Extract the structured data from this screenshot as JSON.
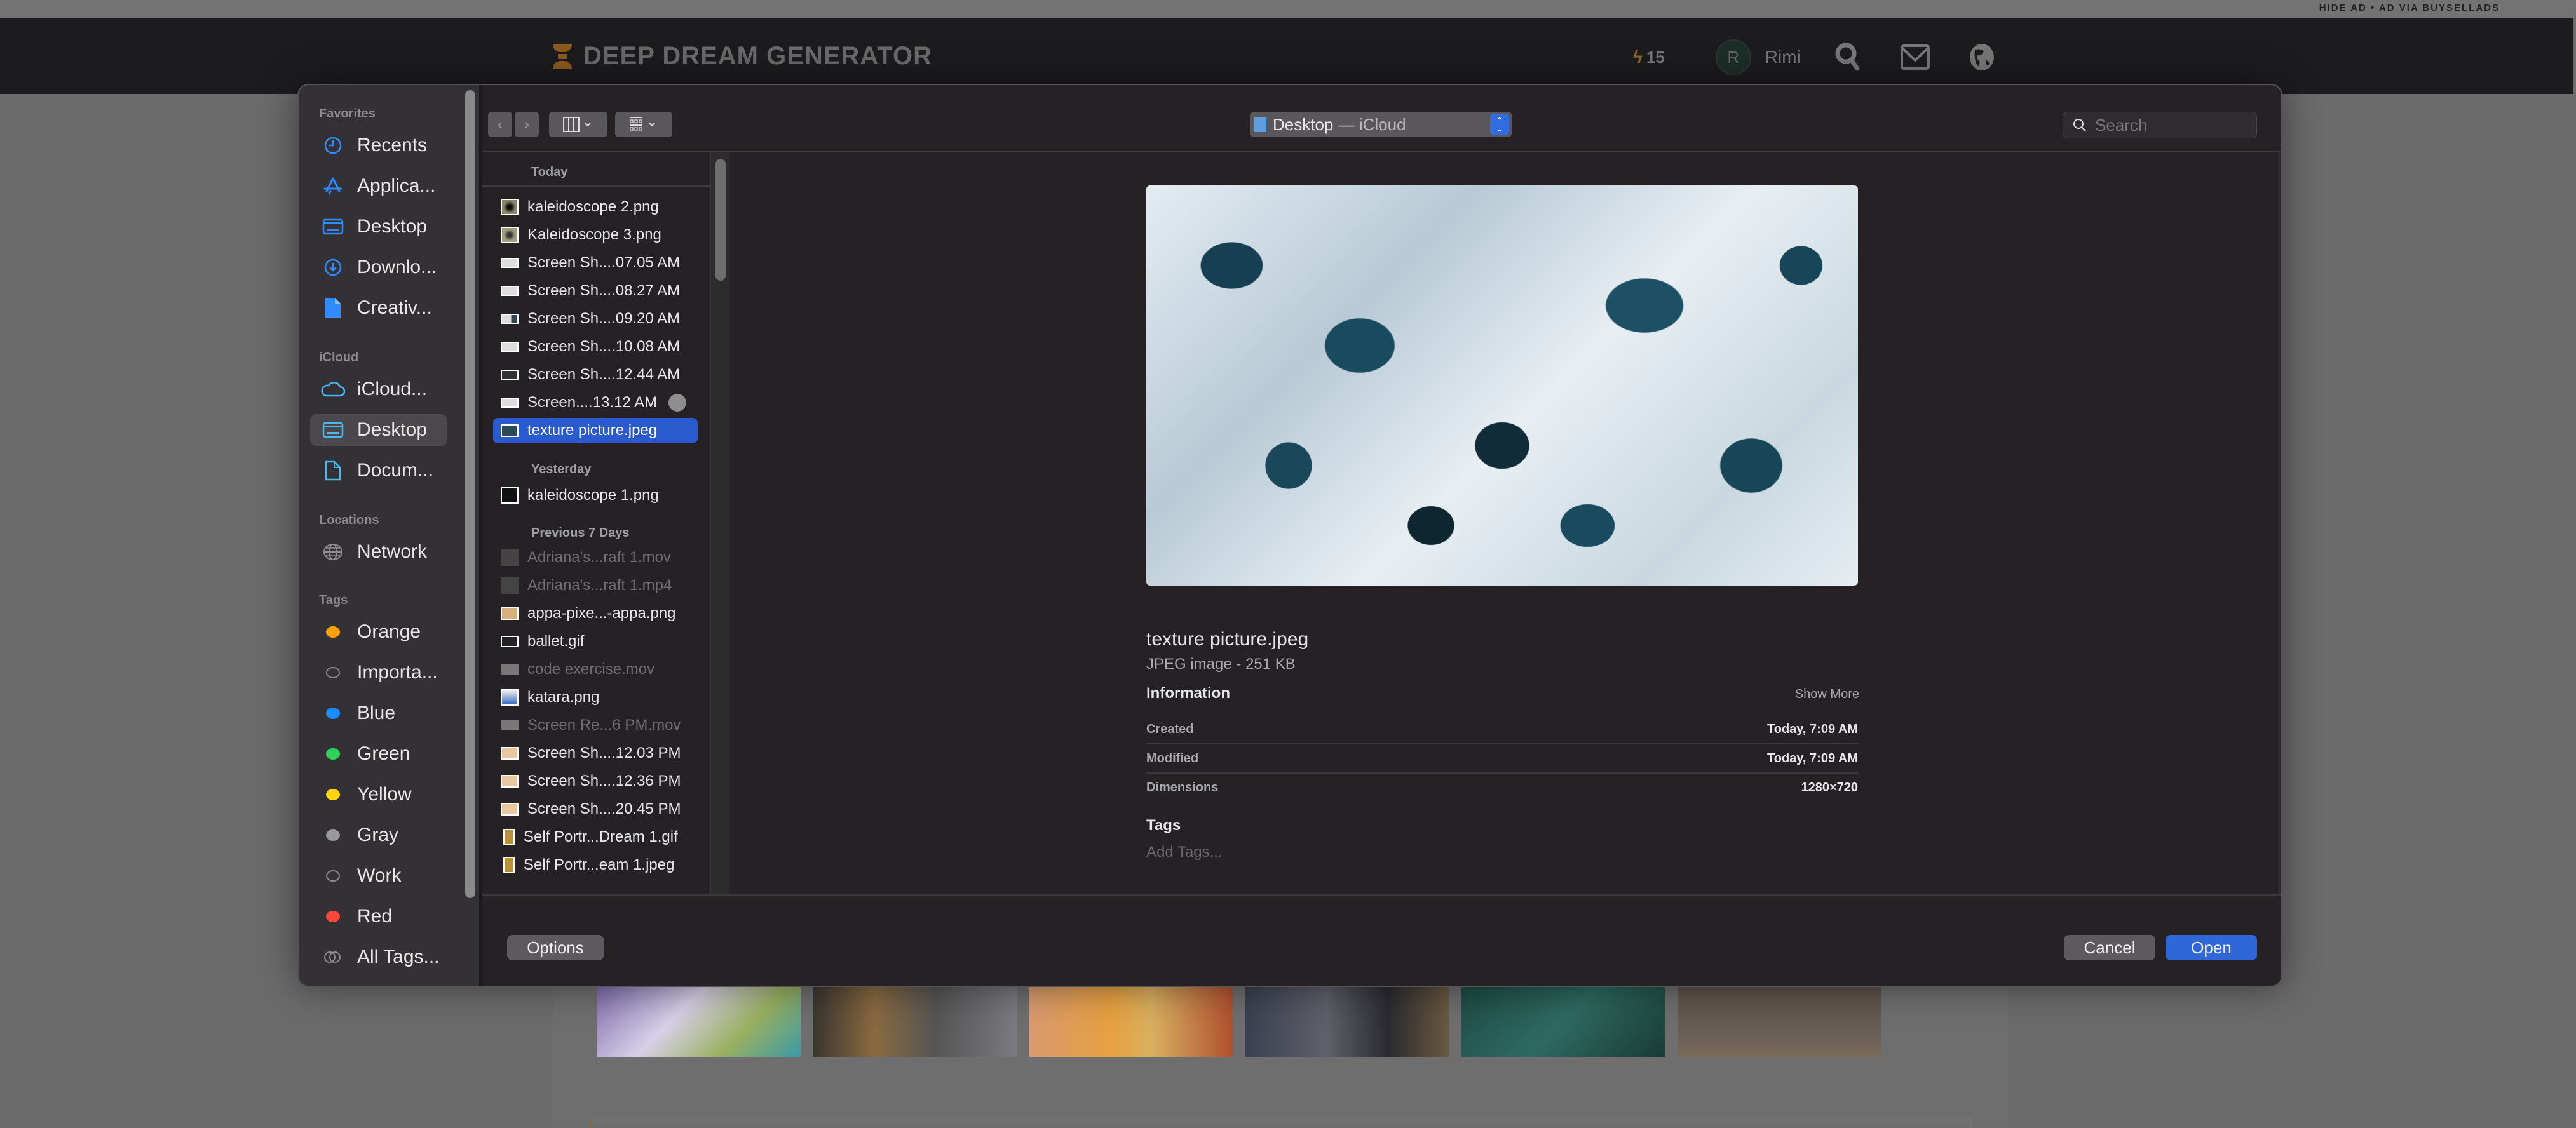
{
  "ad_bar": {
    "text": "HIDE AD • AD VIA BUYSELLADS"
  },
  "site_header": {
    "logo_text": "DEEP DREAM GENERATOR",
    "energy_count": "15",
    "avatar_initial": "R",
    "username": "Rimi",
    "icons": [
      "bolt-icon",
      "search-icon",
      "mail-icon",
      "globe-icon"
    ]
  },
  "dialog": {
    "sidebar": {
      "sections": [
        {
          "title": "Favorites",
          "items": [
            {
              "label": "Recents",
              "icon": "clock-icon"
            },
            {
              "label": "Applica...",
              "icon": "applications-icon"
            },
            {
              "label": "Desktop",
              "icon": "desktop-icon"
            },
            {
              "label": "Downlo...",
              "icon": "download-icon"
            },
            {
              "label": "Creativ...",
              "icon": "document-icon"
            }
          ]
        },
        {
          "title": "iCloud",
          "items": [
            {
              "label": "iCloud...",
              "icon": "cloud-icon"
            },
            {
              "label": "Desktop",
              "icon": "desktop-icon",
              "selected": true
            },
            {
              "label": "Docum...",
              "icon": "document-icon"
            }
          ]
        },
        {
          "title": "Locations",
          "items": [
            {
              "label": "Network",
              "icon": "network-globe-icon"
            }
          ]
        },
        {
          "title": "Tags",
          "items": [
            {
              "label": "Orange",
              "color": "#ff9f0a"
            },
            {
              "label": "Importa...",
              "color": "hollow"
            },
            {
              "label": "Blue",
              "color": "#1e8bff"
            },
            {
              "label": "Green",
              "color": "#30d158"
            },
            {
              "label": "Yellow",
              "color": "#ffd60a"
            },
            {
              "label": "Gray",
              "color": "#98989d"
            },
            {
              "label": "Work",
              "color": "hollow"
            },
            {
              "label": "Red",
              "color": "#ff453a"
            },
            {
              "label": "All Tags...",
              "icon": "all-tags-icon"
            }
          ]
        }
      ]
    },
    "toolbar": {
      "back": "‹",
      "forward": "›",
      "location": "Desktop",
      "location_sub": "— iCloud",
      "search_placeholder": "Search"
    },
    "files": {
      "groups": [
        {
          "title": "Today",
          "items": [
            {
              "name": "kaleidoscope 2.png"
            },
            {
              "name": "Kaleidoscope 3.png"
            },
            {
              "name": "Screen Sh....07.05 AM"
            },
            {
              "name": "Screen Sh....08.27 AM"
            },
            {
              "name": "Screen Sh....09.20 AM"
            },
            {
              "name": "Screen Sh....10.08 AM"
            },
            {
              "name": "Screen Sh....12.44 AM"
            },
            {
              "name": "Screen....13.12 AM",
              "uploading": true
            },
            {
              "name": "texture picture.jpeg",
              "selected": true
            }
          ]
        },
        {
          "title": "Yesterday",
          "items": [
            {
              "name": "kaleidoscope 1.png"
            }
          ]
        },
        {
          "title": "Previous 7 Days",
          "items": [
            {
              "name": "Adriana's...raft 1.mov",
              "dimmed": true
            },
            {
              "name": "Adriana's...raft 1.mp4",
              "dimmed": true
            },
            {
              "name": "appa-pixe...-appa.png"
            },
            {
              "name": "ballet.gif"
            },
            {
              "name": "code exercise.mov",
              "dimmed": true
            },
            {
              "name": "katara.png"
            },
            {
              "name": "Screen Re...6 PM.mov",
              "dimmed": true
            },
            {
              "name": "Screen Sh....12.03 PM"
            },
            {
              "name": "Screen Sh....12.36 PM"
            },
            {
              "name": "Screen Sh....20.45 PM"
            },
            {
              "name": "Self Portr...Dream 1.gif"
            },
            {
              "name": "Self Portr...eam 1.jpeg"
            }
          ]
        }
      ]
    },
    "preview": {
      "name": "texture picture.jpeg",
      "kind": "JPEG image - 251 KB",
      "info_title": "Information",
      "show_more": "Show More",
      "rows": [
        {
          "key": "Created",
          "value": "Today, 7:09 AM"
        },
        {
          "key": "Modified",
          "value": "Today, 7:09 AM"
        },
        {
          "key": "Dimensions",
          "value": "1280×720"
        }
      ],
      "tags_title": "Tags",
      "add_tags": "Add Tags..."
    },
    "buttons": {
      "options": "Options",
      "cancel": "Cancel",
      "open": "Open"
    }
  },
  "colors": {
    "accent": "#2f67d8",
    "selection": "#2a5bce",
    "dialog_bg": "#252125",
    "sidebar_bg": "#333135"
  }
}
